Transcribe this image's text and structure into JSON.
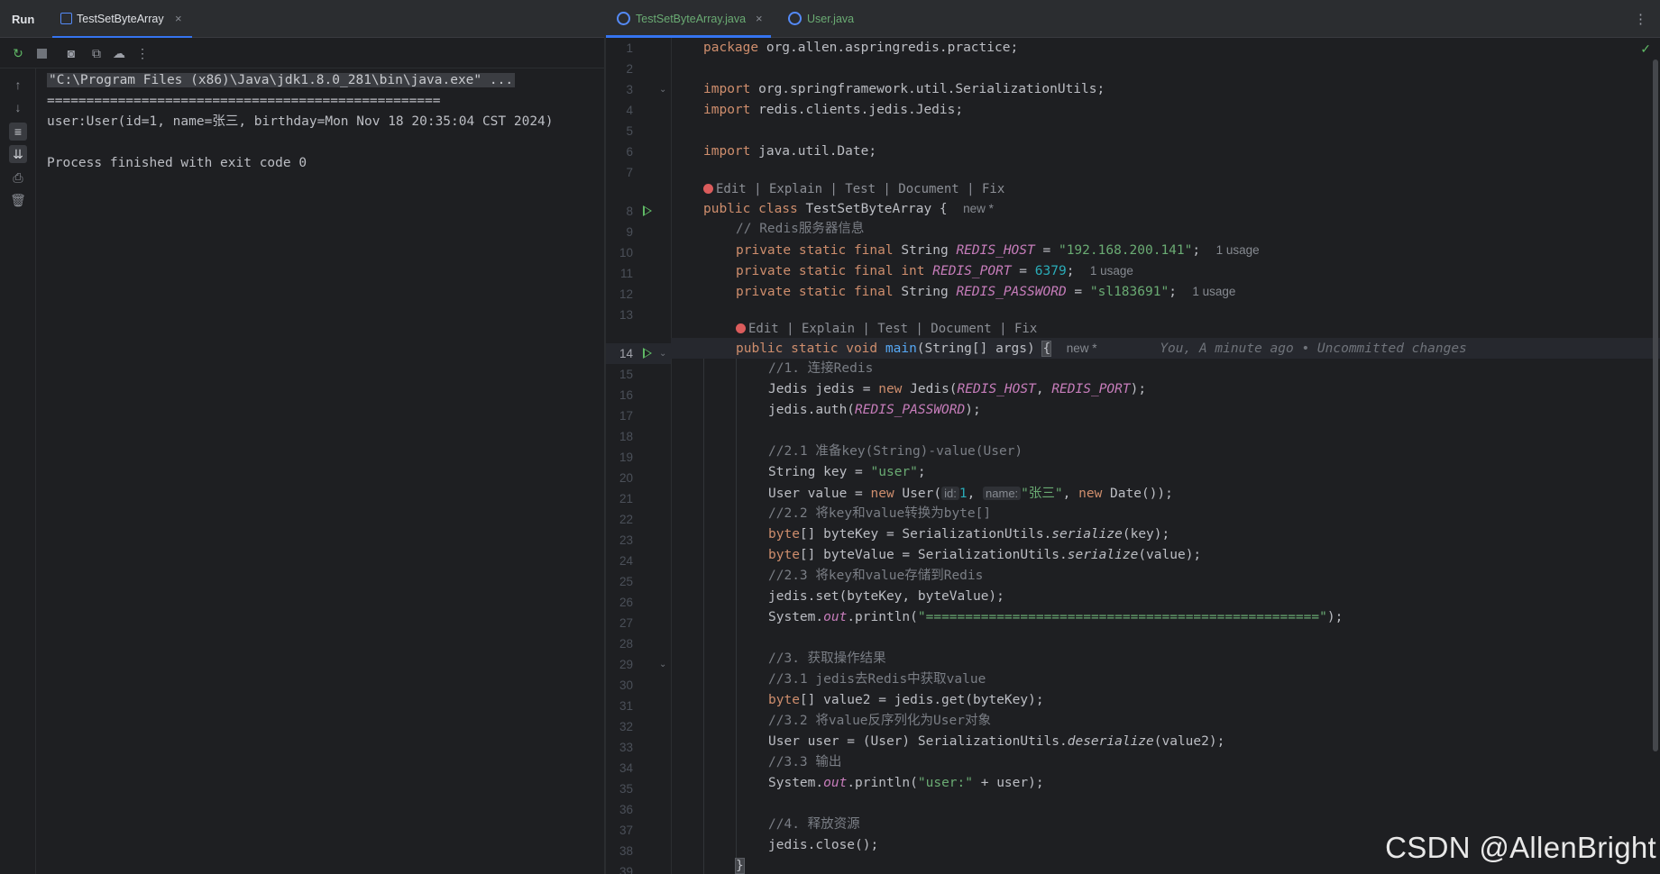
{
  "run_panel": {
    "title": "Run",
    "tab_label": "TestSetByteArray",
    "tab_close": "×",
    "toolbar_icons": [
      "rerun-icon",
      "stop-icon",
      "camera-icon",
      "restore-layout-icon",
      "coverage-icon",
      "more-icon"
    ],
    "side_icons": [
      "up-arrow-icon",
      "down-arrow-icon",
      "soft-wrap-icon",
      "scroll-to-end-icon",
      "print-icon",
      "trash-icon"
    ],
    "console": {
      "command": "\"C:\\Program Files (x86)\\Java\\jdk1.8.0_281\\bin\\java.exe\" ...",
      "separator": "==================================================",
      "output": "user:User(id=1, name=张三, birthday=Mon Nov 18 20:35:04 CST 2024)",
      "blank": "",
      "exit": "Process finished with exit code 0"
    }
  },
  "editor": {
    "tabs": [
      {
        "label": "TestSetByteArray.java",
        "close": "×",
        "active": true
      },
      {
        "label": "User.java",
        "active": false
      }
    ],
    "menu_icon": "⋮",
    "check_icon": "✓",
    "line_numbers": [
      "1",
      "2",
      "3",
      "4",
      "5",
      "6",
      "7",
      "8",
      "9",
      "10",
      "11",
      "12",
      "13",
      "14",
      "15",
      "16",
      "17",
      "18",
      "19",
      "20",
      "21",
      "22",
      "23",
      "24",
      "25",
      "26",
      "27",
      "28",
      "29",
      "30",
      "31",
      "32",
      "33",
      "34",
      "35",
      "36",
      "37",
      "38",
      "39"
    ],
    "code": {
      "l1": {
        "kw": "package",
        "rest": " org.allen.aspringredis.practice;"
      },
      "l3": {
        "kw": "import",
        "rest": " org.springframework.util.SerializationUtils;"
      },
      "l4": {
        "kw": "import",
        "rest": " redis.clients.jedis.Jedis;"
      },
      "l6": {
        "kw": "import",
        "rest": " java.util.Date;"
      },
      "lens": "Edit | Explain | Test | Document | Fix",
      "l8": {
        "kw": "public class",
        "name": " TestSetByteArray {",
        "hint": "new *"
      },
      "l9": {
        "comment": "// Redis服务器信息"
      },
      "l10": {
        "kw": "private static final",
        "type": " String ",
        "field": "REDIS_HOST",
        "eq": " = ",
        "val": "\"192.168.200.141\"",
        "end": ";",
        "hint": "1 usage"
      },
      "l11": {
        "kw": "private static final int",
        "type": " ",
        "field": "REDIS_PORT",
        "eq": " = ",
        "val": "6379",
        "end": ";",
        "hint": "1 usage"
      },
      "l12": {
        "kw": "private static final",
        "type": " String ",
        "field": "REDIS_PASSWORD",
        "eq": " = ",
        "val": "\"sl183691\"",
        "end": ";",
        "hint": "1 usage"
      },
      "l14": {
        "kw": "public static void",
        "fn": "main",
        "args": "(String[] args) ",
        "brace": "{",
        "hint": "new *",
        "blame": "You, A minute ago • Uncommitted changes"
      },
      "l15": {
        "comment": "//1. 连接Redis"
      },
      "l16": {
        "a": "Jedis jedis = ",
        "kw": "new",
        "b": " Jedis(",
        "f1": "REDIS_HOST",
        "c": ", ",
        "f2": "REDIS_PORT",
        "d": ");"
      },
      "l17": {
        "a": "jedis.auth(",
        "f1": "REDIS_PASSWORD",
        "b": ");"
      },
      "l19": {
        "comment": "//2.1 准备key(String)-value(User)"
      },
      "l20": {
        "a": "String key = ",
        "val": "\"user\"",
        "b": ";"
      },
      "l21": {
        "a": "User value = ",
        "kw": "new",
        "b": " User(",
        "inlay1": "id:",
        "num": "1",
        "c": ", ",
        "inlay2": "name:",
        "val": "\"张三\"",
        "d": ", ",
        "kw2": "new",
        "e": " Date());"
      },
      "l22": {
        "comment": "//2.2 将key和value转换为byte[]"
      },
      "l23": {
        "kw": "byte",
        "a": "[] byteKey = SerializationUtils.",
        "fn": "serialize",
        "b": "(key);"
      },
      "l24": {
        "kw": "byte",
        "a": "[] byteValue = SerializationUtils.",
        "fn": "serialize",
        "b": "(value);"
      },
      "l25": {
        "comment": "//2.3 将key和value存储到Redis"
      },
      "l26": {
        "a": "jedis.set(byteKey, byteValue);"
      },
      "l27": {
        "a": "System.",
        "f1": "out",
        "b": ".println(",
        "val": "\"==================================================\"",
        "c": ");"
      },
      "l29": {
        "comment": "//3. 获取操作结果"
      },
      "l30": {
        "comment": "//3.1 jedis去Redis中获取value"
      },
      "l31": {
        "kw": "byte",
        "a": "[] value2 = jedis.get(byteKey);"
      },
      "l32": {
        "comment": "//3.2 将value反序列化为User对象"
      },
      "l33": {
        "a": "User user = (User) SerializationUtils.",
        "fn": "deserialize",
        "b": "(value2);"
      },
      "l34": {
        "comment": "//3.3 输出"
      },
      "l35": {
        "a": "System.",
        "f1": "out",
        "b": ".println(",
        "val": "\"user:\"",
        "c": " + user);"
      },
      "l37": {
        "comment": "//4. 释放资源"
      },
      "l38": {
        "a": "jedis.close();"
      },
      "l39": {
        "brace": "}"
      }
    }
  },
  "watermark": "CSDN @AllenBright"
}
